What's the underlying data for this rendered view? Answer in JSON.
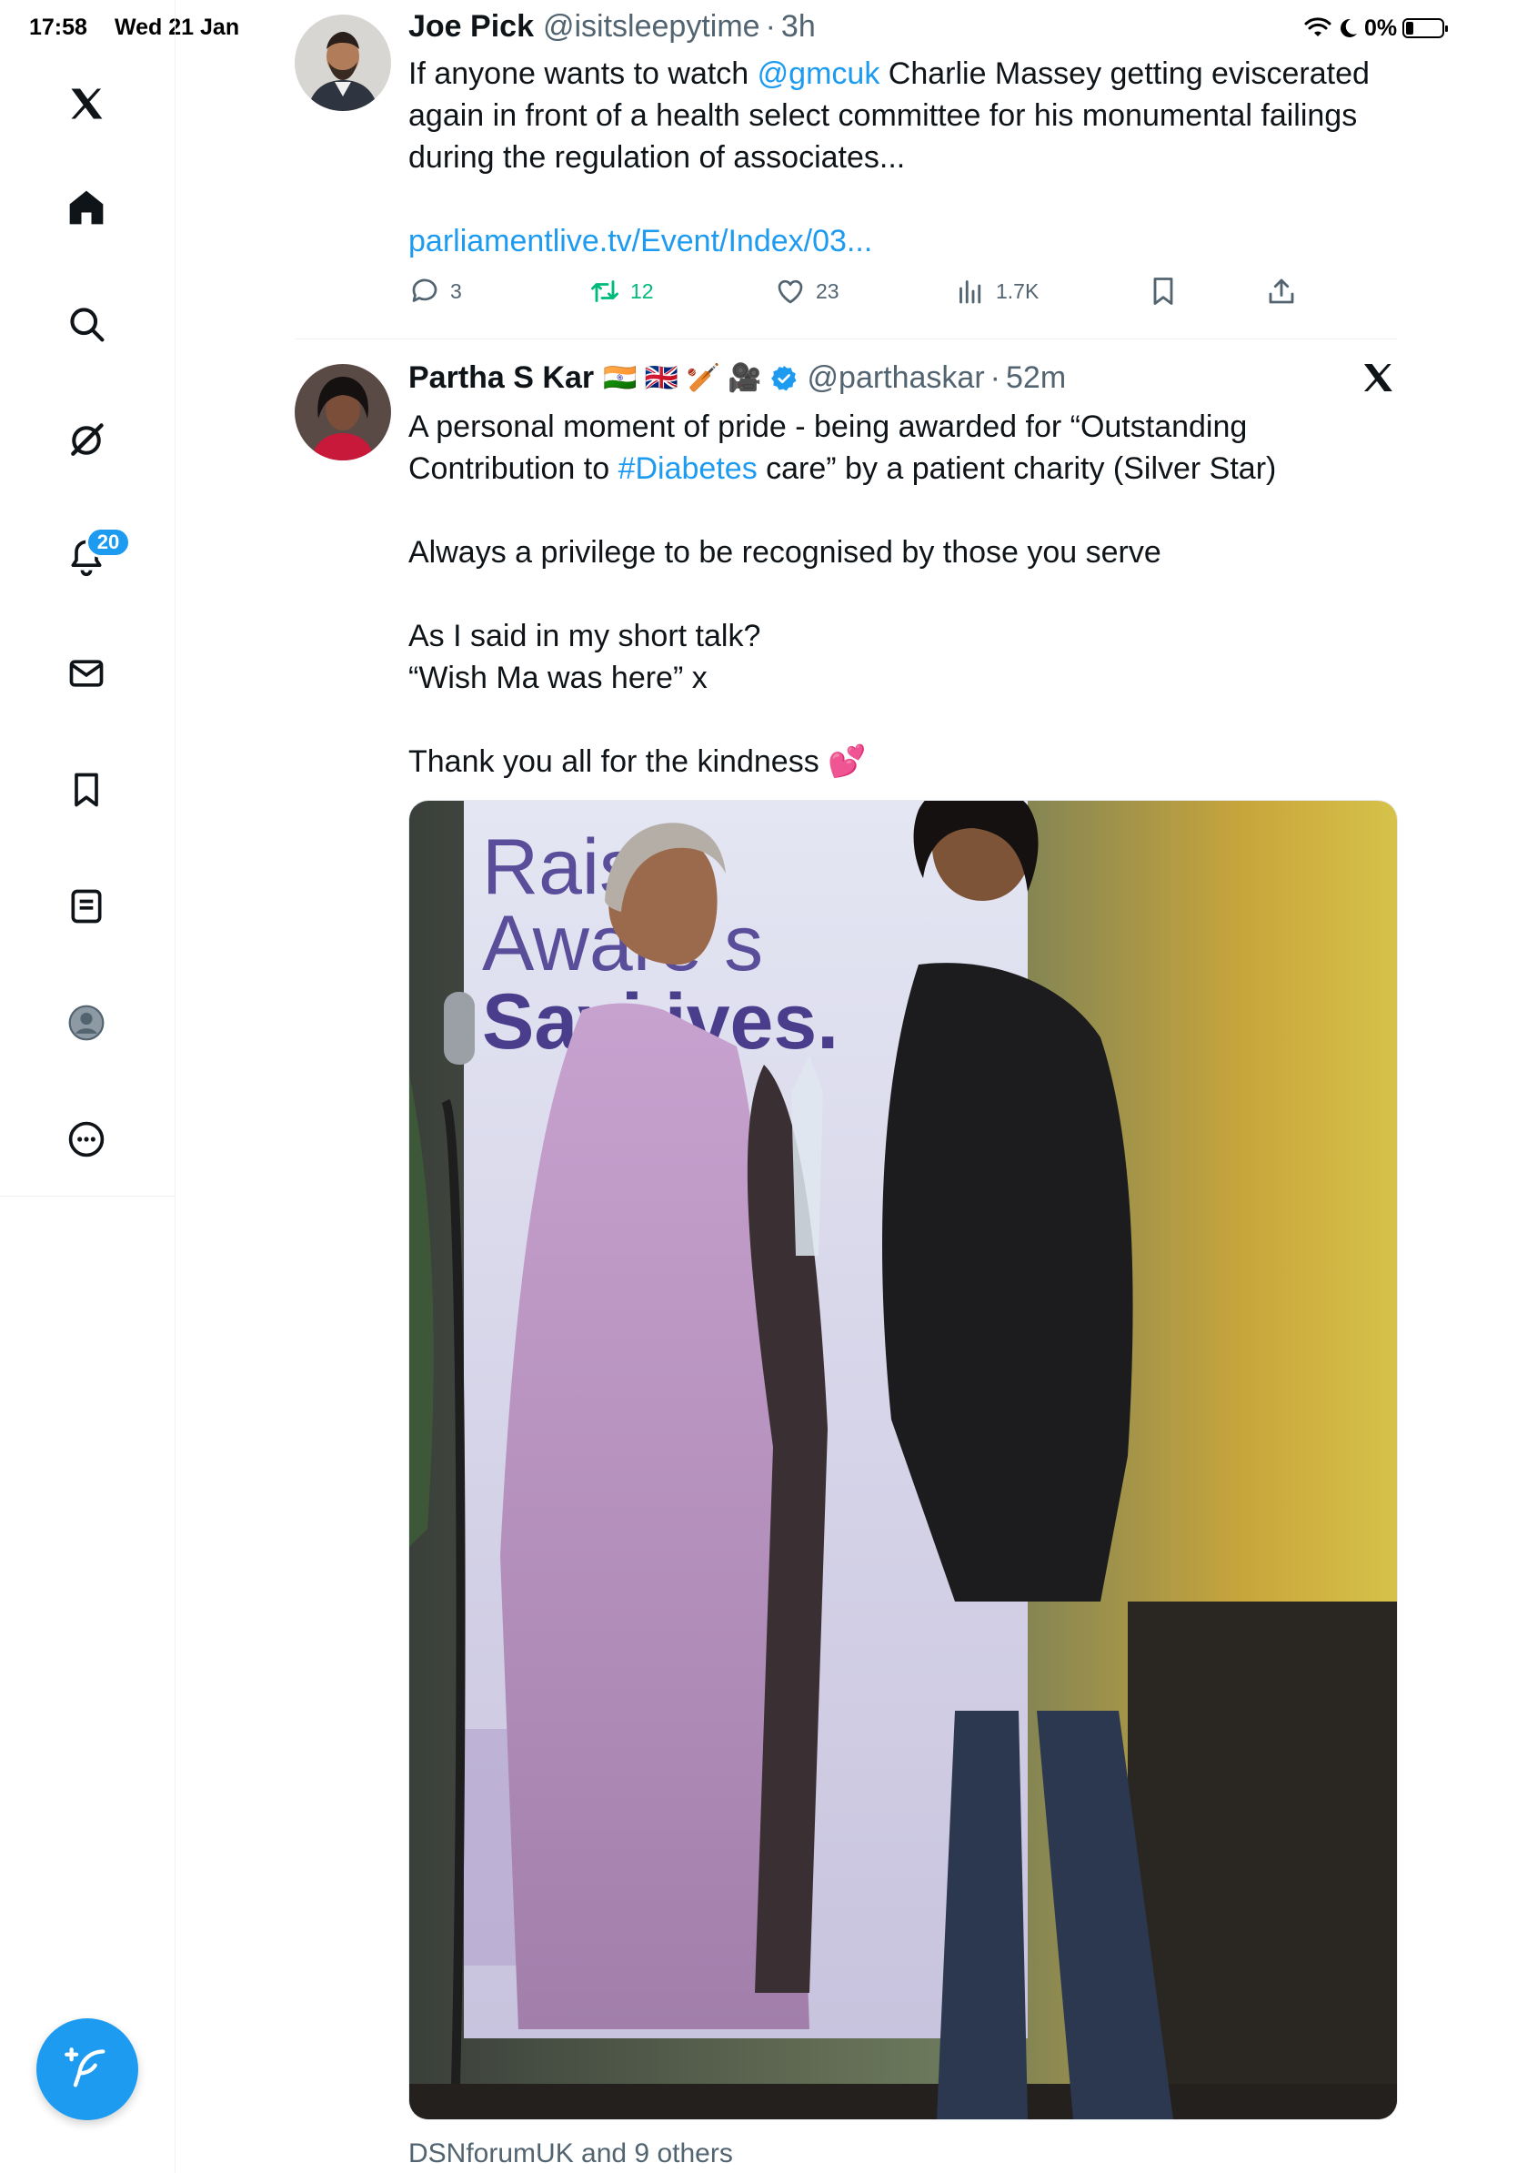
{
  "status_bar": {
    "time": "17:58",
    "date": "Wed 21 Jan",
    "battery": "0%",
    "battery_level": 0.2
  },
  "sidebar": {
    "items": [
      {
        "icon": "x-logo-icon"
      },
      {
        "icon": "home-icon"
      },
      {
        "icon": "search-icon"
      },
      {
        "icon": "grok-icon"
      },
      {
        "icon": "bell-icon",
        "badge": "20"
      },
      {
        "icon": "mail-icon"
      },
      {
        "icon": "bookmark-icon"
      },
      {
        "icon": "lists-icon"
      },
      {
        "icon": "profile-icon"
      },
      {
        "icon": "more-icon"
      }
    ],
    "compose_icon": "compose-feather-icon"
  },
  "tweets": [
    {
      "name": "Joe Pick",
      "handle": "@isitsleepytime",
      "time": "3h",
      "text_before": "If anyone wants to watch ",
      "mention": "@gmcuk",
      "text_after": " Charlie Massey getting eviscerated again in front of a health select committee for his monumental failings during the regulation of associates...",
      "link": "parliamentlive.tv/Event/Index/03...",
      "stats": {
        "replies": "3",
        "retweets": "12",
        "likes": "23",
        "views": "1.7K"
      }
    },
    {
      "name": "Partha S Kar",
      "flags": "🇮🇳 🇬🇧 🏏 🎥",
      "handle": "@parthaskar",
      "time": "52m",
      "line1_a": "A personal moment of pride - being awarded for “Outstanding",
      "line1_b": "Contribution to ",
      "hashtag": "#Diabetes",
      "line1_c": " care” by a patient charity (Silver Star)",
      "line2": "Always a privilege to be recognised by those you serve",
      "line3": "As I said in my short talk?",
      "line4": "“Wish Ma was here” x",
      "line5": "Thank you all for the kindness 💕",
      "photo_banner_1": "Raisin",
      "photo_banner_2": "Aware  s",
      "photo_banner_3": "Savi   ives.",
      "liked_by": "DSNforumUK and 9 others"
    }
  ],
  "colors": {
    "accent": "#1d9bf0",
    "retweet": "#00ba7c",
    "muted": "#536471",
    "text": "#0f1419"
  }
}
